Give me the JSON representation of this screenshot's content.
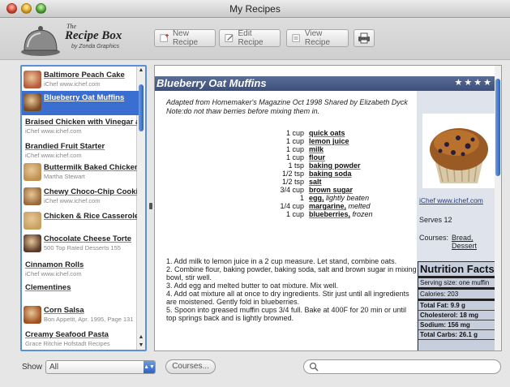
{
  "window": {
    "title": "My Recipes"
  },
  "toolbar": {
    "logo_the": "The",
    "logo_title": "Recipe Box",
    "logo_sub": "by Zonda Graphics",
    "new_label": "New Recipe",
    "edit_label": "Edit Recipe",
    "view_label": "View Recipe"
  },
  "recipes": [
    {
      "name": "Baltimore Peach Cake",
      "sub": "iChef www.ichef.com",
      "thumb": "#b85a3a"
    },
    {
      "name": "Blueberry Oat Muffins",
      "sub": "",
      "thumb": "#7a4a22"
    },
    {
      "name": "Braised Chicken with Vinegar and ...",
      "sub": "iChef www.ichef.com",
      "thumb": ""
    },
    {
      "name": "Brandied Fruit Starter",
      "sub": "iChef www.ichef.com",
      "thumb": ""
    },
    {
      "name": "Buttermilk Baked Chicken",
      "sub": "Martha Stewart",
      "thumb": "#c09050"
    },
    {
      "name": "Chewy Choco-Chip Cookies",
      "sub": "iChef www.ichef.com",
      "thumb": "#9a6a3a"
    },
    {
      "name": "Chicken & Rice Casserole - M...",
      "sub": "",
      "thumb": "#c8a060"
    },
    {
      "name": "Chocolate Cheese Torte",
      "sub": "500 Top Rated Desserts 155",
      "thumb": "#5a3a2a"
    },
    {
      "name": "Cinnamon Rolls",
      "sub": "iChef www.ichef.com",
      "thumb": ""
    },
    {
      "name": "Clementines",
      "sub": "",
      "thumb": ""
    },
    {
      "name": "Corn Salsa",
      "sub": "Bon Appetit, Apr. 1995, Page 131",
      "thumb": "#a05020"
    },
    {
      "name": "Creamy Seafood Pasta",
      "sub": "Grace Ritchie Hofstadt Recipes",
      "thumb": ""
    }
  ],
  "recipe": {
    "title": "Blueberry Oat Muffins",
    "rating": "★★★★",
    "intro_1": "Adapted from Homemaker's Magazine Oct 1998 Shared by Elizabeth Dyck",
    "intro_2": "Note:do not thaw berries before mixing them in.",
    "ingredients": [
      {
        "qty": "1 cup",
        "name": "quick oats",
        "note": ""
      },
      {
        "qty": "1 cup",
        "name": "lemon juice",
        "note": ""
      },
      {
        "qty": "1 cup",
        "name": "milk",
        "note": ""
      },
      {
        "qty": "1 cup",
        "name": "flour",
        "note": ""
      },
      {
        "qty": "1 tsp",
        "name": "baking powder",
        "note": ""
      },
      {
        "qty": "1/2 tsp",
        "name": "baking soda",
        "note": ""
      },
      {
        "qty": "1/2 tsp",
        "name": "salt",
        "note": ""
      },
      {
        "qty": "3/4 cup",
        "name": "brown sugar",
        "note": ""
      },
      {
        "qty": "1",
        "name": "egg,",
        "note": "lightly beaten"
      },
      {
        "qty": "1/4 cup",
        "name": "margarine,",
        "note": "melted"
      },
      {
        "qty": "1 cup",
        "name": "blueberries,",
        "note": "frozen"
      }
    ],
    "steps": [
      "1. Add milk to lemon juice in a 2 cup measure. Let stand, combine oats.",
      "2. Combine flour, baking powder, baking soda, salt and brown sugar in mixing bowl, stir well.",
      "3. Add egg and melted butter to oat mixture. Mix well.",
      "4. Add oat mixture all at once to dry ingredients. Stir just until all ingredients are moistened. Gently fold in blueberries.",
      "5. Spoon into greased muffin cups 3/4 full. Bake at 400F for 20 min or until top springs back and is lightly browned."
    ],
    "source_link": "iChef www.ichef.com",
    "serves": "Serves 12",
    "courses_label": "Courses:",
    "courses": "Bread, Dessert"
  },
  "nutrition": {
    "title": "Nutrition Facts",
    "serving": "Serving size: one muffin",
    "calories": "Calories: 203",
    "fat": "Total Fat: 9.9 g",
    "cholesterol": "Cholesterol: 18 mg",
    "sodium": "Sodium: 156 mg",
    "carbs": "Total Carbs: 26.1 g"
  },
  "bottom": {
    "show_label": "Show",
    "show_value": "All",
    "courses_button": "Courses...",
    "search_placeholder": ""
  },
  "colors": {
    "selection": "#3a6fd1",
    "header": "#3c4f7a",
    "side": "#dfe3ec"
  }
}
